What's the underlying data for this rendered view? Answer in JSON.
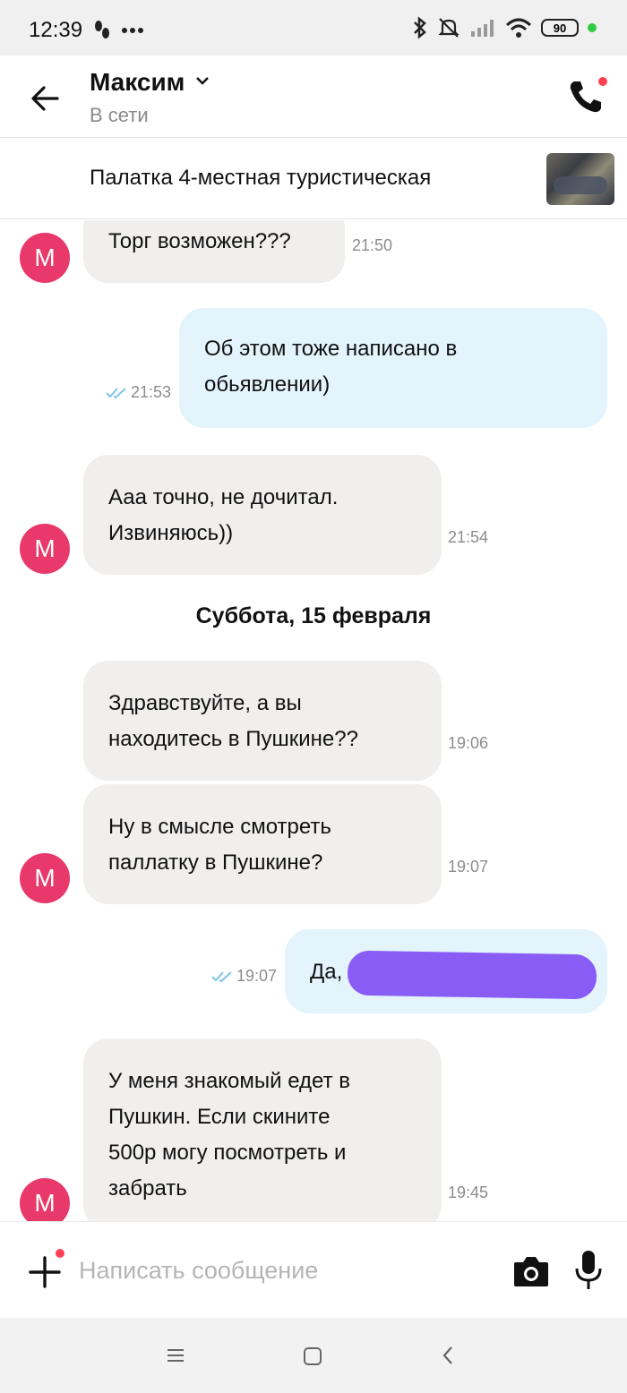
{
  "status_bar": {
    "time": "12:39",
    "battery": "90"
  },
  "header": {
    "contact_name": "Максим",
    "status": "В сети"
  },
  "listing": {
    "title": "Палатка 4-местная туристическая"
  },
  "messages": [
    {
      "dir": "in",
      "lines": [
        "Торг возможен???"
      ],
      "time": "21:50"
    },
    {
      "dir": "out",
      "lines": [
        "Об этом тоже написано в",
        "обьявлении)"
      ],
      "time": "21:53"
    },
    {
      "dir": "in",
      "lines": [
        "Ааа точно, не дочитал.",
        "Извиняюсь))"
      ],
      "time": "21:54"
    },
    {
      "dir": "in",
      "lines": [
        "Здравствуйте,  а вы",
        "находитесь в Пушкине??"
      ],
      "time": "19:06"
    },
    {
      "dir": "in",
      "lines": [
        "Ну в смысле смотреть",
        "паллатку в Пушкине?"
      ],
      "time": "19:07"
    },
    {
      "dir": "out",
      "lines": [
        "Да,"
      ],
      "time": "19:07"
    },
    {
      "dir": "in",
      "lines": [
        "У меня знакомый едет в",
        "Пушкин. Если скините",
        "500р могу посмотреть  и",
        "забрать"
      ],
      "time": "19:45"
    }
  ],
  "avatar_letter": "M",
  "date_separator": "Суббота, 15 февраля",
  "input": {
    "placeholder": "Написать сообщение"
  },
  "colors": {
    "accent_red": "#ff4053",
    "avatar": "#e8396a",
    "incoming": "#f0efee",
    "outgoing": "#e3f4fd",
    "tick": "#7fc4ea"
  }
}
